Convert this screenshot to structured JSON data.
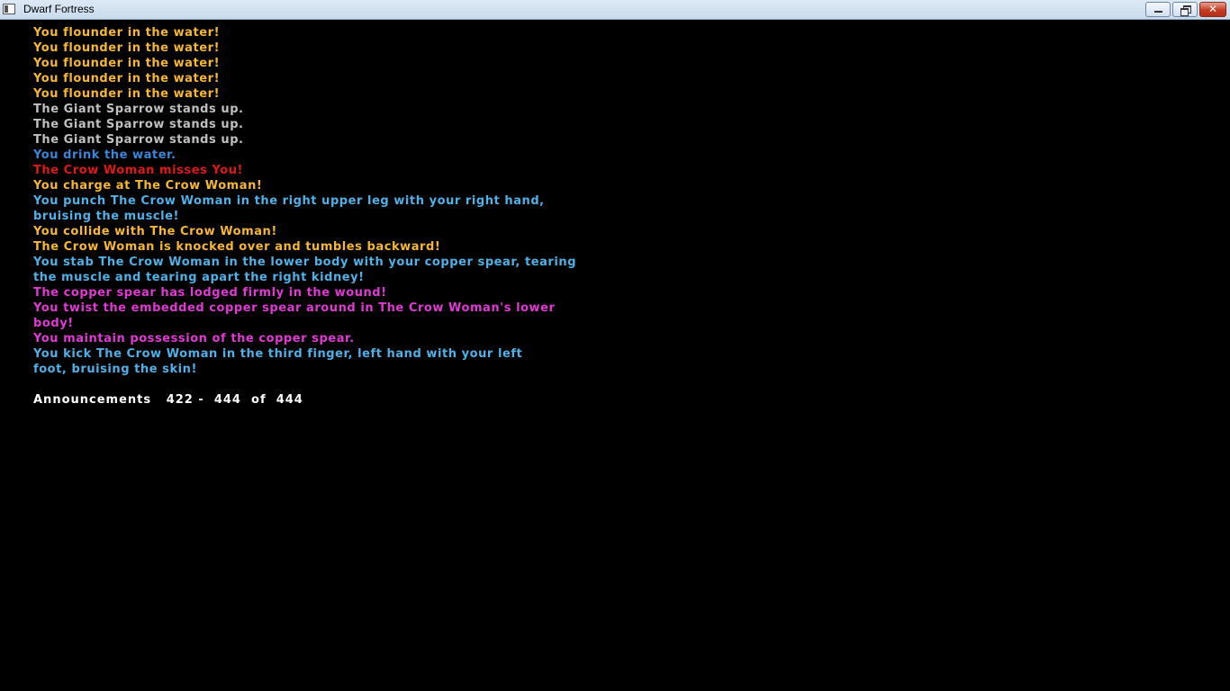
{
  "window": {
    "title": "Dwarf Fortress",
    "close_glyph": "✕"
  },
  "announcements": [
    {
      "text": "You flounder in the water!",
      "color": "#f7b733"
    },
    {
      "text": "You flounder in the water!",
      "color": "#f7b733"
    },
    {
      "text": "You flounder in the water!",
      "color": "#f7b733"
    },
    {
      "text": "You flounder in the water!",
      "color": "#f7b733"
    },
    {
      "text": "You flounder in the water!",
      "color": "#f7b733"
    },
    {
      "text": "The Giant Sparrow stands up.",
      "color": "#c0c0c0"
    },
    {
      "text": "The Giant Sparrow stands up.",
      "color": "#c0c0c0"
    },
    {
      "text": "The Giant Sparrow stands up.",
      "color": "#c0c0c0"
    },
    {
      "text": "You drink the water.",
      "color": "#3a86d8"
    },
    {
      "text": "The Crow Woman misses You!",
      "color": "#e01818"
    },
    {
      "text": "You charge at The Crow Woman!",
      "color": "#f7b733"
    },
    {
      "text": "You punch The Crow Woman in the right upper leg with your right hand,",
      "color": "#4fb1e8"
    },
    {
      "text": "bruising the muscle!",
      "color": "#4fb1e8"
    },
    {
      "text": "You collide with The Crow Woman!",
      "color": "#f7b733"
    },
    {
      "text": "The Crow Woman is knocked over and tumbles backward!",
      "color": "#f7b733"
    },
    {
      "text": "You stab The Crow Woman in the lower body with your copper spear, tearing",
      "color": "#4fb1e8"
    },
    {
      "text": "the muscle and tearing apart the right kidney!",
      "color": "#4fb1e8"
    },
    {
      "text": "The copper spear has lodged firmly in the wound!",
      "color": "#e039d4"
    },
    {
      "text": "You twist the embedded copper spear around in The Crow Woman's lower",
      "color": "#e039d4"
    },
    {
      "text": "body!",
      "color": "#e039d4"
    },
    {
      "text": "You maintain possession of the copper spear.",
      "color": "#e039d4"
    },
    {
      "text": "You kick The Crow Woman in the third finger, left hand with your left",
      "color": "#4fb1e8"
    },
    {
      "text": "foot, bruising the skin!",
      "color": "#4fb1e8"
    }
  ],
  "footer": {
    "label": "Announcements",
    "range_start": "422",
    "dash": "-",
    "range_end": "444",
    "of": "of",
    "total": "444"
  }
}
